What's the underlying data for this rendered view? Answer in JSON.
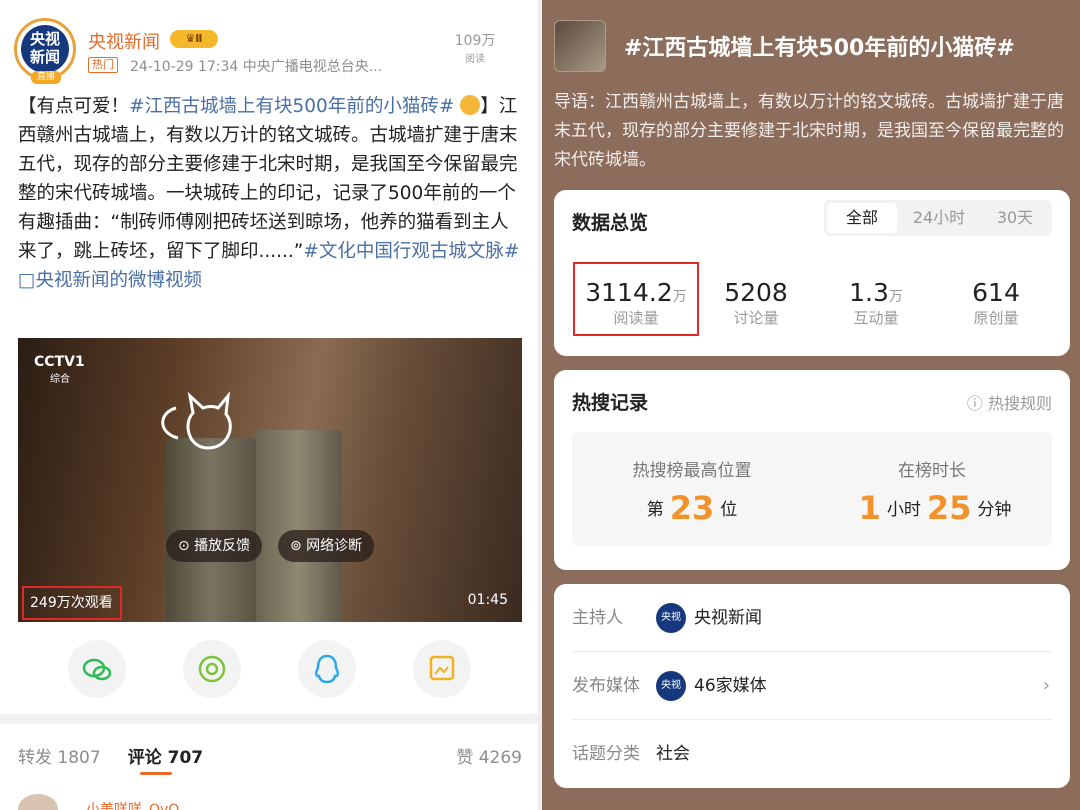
{
  "post": {
    "author": "央视新闻",
    "vip": "♛Ⅱ",
    "avatar_text": "央视\n新闻",
    "live": "直播",
    "hot_tag": "热门",
    "meta": "24-10-29 17:34  中央广播电视总台央...",
    "reads_count": "109万",
    "reads_label": "阅读",
    "text_prefix": "【有点可爱！",
    "topic1": "#江西古城墙上有块500年前的小猫砖#",
    "text_body": "】江西赣州古城墙上，有数以万计的铭文城砖。古城墙扩建于唐末五代，现存的部分主要修建于北宋时期，是我国至今保留最完整的宋代砖城墙。一块城砖上的印记，记录了500年前的一个有趣插曲：“制砖师傅刚把砖坯送到晾场，他养的猫看到主人来了，跳上砖坯，留下了脚印......”",
    "topic2": "#文化中国行观古城文脉#",
    "video_link": "□央视新闻的微博视频"
  },
  "video": {
    "channel": "CCTV1",
    "channel_sub": "综合",
    "feedback_button": "⊙ 播放反馈",
    "network_button": "⊚ 网络诊断",
    "views": "249万次观看",
    "duration": "01:45"
  },
  "share": [
    "wechat-icon",
    "moments-icon",
    "qq-icon",
    "save-image-icon"
  ],
  "interactions": {
    "repost": "转发 1807",
    "comments": "评论 707",
    "likes": "赞 4269",
    "first_commenter": "小美咩咩_OvO"
  },
  "topic": {
    "title": "#江西古城墙上有块500年前的小猫砖#",
    "lead": "导语：江西赣州古城墙上，有数以万计的铭文城砖。古城墙扩建于唐末五代，现存的部分主要修建于北宋时期，是我国至今保留最完整的宋代砖城墙。"
  },
  "overview": {
    "title": "数据总览",
    "tabs": [
      "全部",
      "24小时",
      "30天"
    ],
    "stats": [
      {
        "value": "3114.2",
        "unit": "万",
        "label": "阅读量"
      },
      {
        "value": "5208",
        "unit": "",
        "label": "讨论量"
      },
      {
        "value": "1.3",
        "unit": "万",
        "label": "互动量"
      },
      {
        "value": "614",
        "unit": "",
        "label": "原创量"
      }
    ]
  },
  "hotsearch": {
    "title": "热搜记录",
    "rule": "ⓘ 热搜规则",
    "peak_label": "热搜榜最高位置",
    "peak_prefix": "第",
    "peak_value": "23",
    "peak_suffix": "位",
    "duration_label": "在榜时长",
    "hours": "1",
    "hours_unit": "小时",
    "minutes": "25",
    "minutes_unit": "分钟"
  },
  "info": {
    "host_label": "主持人",
    "host": "央视新闻",
    "media_label": "发布媒体",
    "media": "46家媒体",
    "category_label": "话题分类",
    "category": "社会"
  }
}
